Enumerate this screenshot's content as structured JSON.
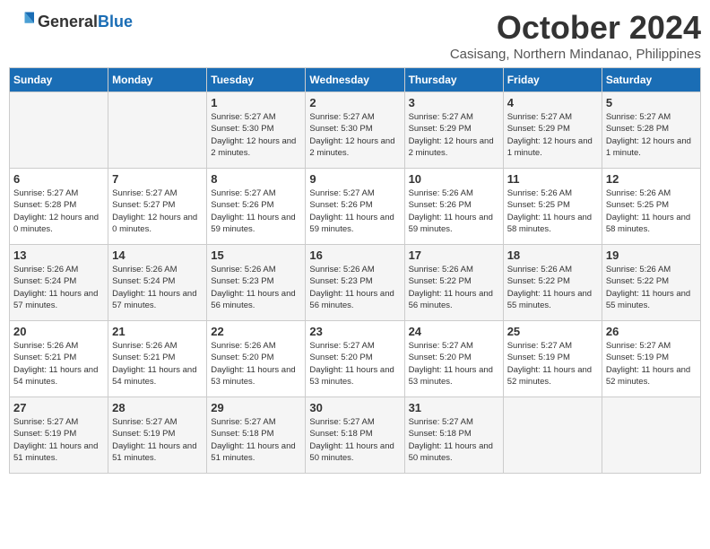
{
  "header": {
    "logo_general": "General",
    "logo_blue": "Blue",
    "month_year": "October 2024",
    "location": "Casisang, Northern Mindanao, Philippines"
  },
  "days_of_week": [
    "Sunday",
    "Monday",
    "Tuesday",
    "Wednesday",
    "Thursday",
    "Friday",
    "Saturday"
  ],
  "weeks": [
    [
      {
        "day": "",
        "info": ""
      },
      {
        "day": "",
        "info": ""
      },
      {
        "day": "1",
        "info": "Sunrise: 5:27 AM\nSunset: 5:30 PM\nDaylight: 12 hours and 2 minutes."
      },
      {
        "day": "2",
        "info": "Sunrise: 5:27 AM\nSunset: 5:30 PM\nDaylight: 12 hours and 2 minutes."
      },
      {
        "day": "3",
        "info": "Sunrise: 5:27 AM\nSunset: 5:29 PM\nDaylight: 12 hours and 2 minutes."
      },
      {
        "day": "4",
        "info": "Sunrise: 5:27 AM\nSunset: 5:29 PM\nDaylight: 12 hours and 1 minute."
      },
      {
        "day": "5",
        "info": "Sunrise: 5:27 AM\nSunset: 5:28 PM\nDaylight: 12 hours and 1 minute."
      }
    ],
    [
      {
        "day": "6",
        "info": "Sunrise: 5:27 AM\nSunset: 5:28 PM\nDaylight: 12 hours and 0 minutes."
      },
      {
        "day": "7",
        "info": "Sunrise: 5:27 AM\nSunset: 5:27 PM\nDaylight: 12 hours and 0 minutes."
      },
      {
        "day": "8",
        "info": "Sunrise: 5:27 AM\nSunset: 5:26 PM\nDaylight: 11 hours and 59 minutes."
      },
      {
        "day": "9",
        "info": "Sunrise: 5:27 AM\nSunset: 5:26 PM\nDaylight: 11 hours and 59 minutes."
      },
      {
        "day": "10",
        "info": "Sunrise: 5:26 AM\nSunset: 5:26 PM\nDaylight: 11 hours and 59 minutes."
      },
      {
        "day": "11",
        "info": "Sunrise: 5:26 AM\nSunset: 5:25 PM\nDaylight: 11 hours and 58 minutes."
      },
      {
        "day": "12",
        "info": "Sunrise: 5:26 AM\nSunset: 5:25 PM\nDaylight: 11 hours and 58 minutes."
      }
    ],
    [
      {
        "day": "13",
        "info": "Sunrise: 5:26 AM\nSunset: 5:24 PM\nDaylight: 11 hours and 57 minutes."
      },
      {
        "day": "14",
        "info": "Sunrise: 5:26 AM\nSunset: 5:24 PM\nDaylight: 11 hours and 57 minutes."
      },
      {
        "day": "15",
        "info": "Sunrise: 5:26 AM\nSunset: 5:23 PM\nDaylight: 11 hours and 56 minutes."
      },
      {
        "day": "16",
        "info": "Sunrise: 5:26 AM\nSunset: 5:23 PM\nDaylight: 11 hours and 56 minutes."
      },
      {
        "day": "17",
        "info": "Sunrise: 5:26 AM\nSunset: 5:22 PM\nDaylight: 11 hours and 56 minutes."
      },
      {
        "day": "18",
        "info": "Sunrise: 5:26 AM\nSunset: 5:22 PM\nDaylight: 11 hours and 55 minutes."
      },
      {
        "day": "19",
        "info": "Sunrise: 5:26 AM\nSunset: 5:22 PM\nDaylight: 11 hours and 55 minutes."
      }
    ],
    [
      {
        "day": "20",
        "info": "Sunrise: 5:26 AM\nSunset: 5:21 PM\nDaylight: 11 hours and 54 minutes."
      },
      {
        "day": "21",
        "info": "Sunrise: 5:26 AM\nSunset: 5:21 PM\nDaylight: 11 hours and 54 minutes."
      },
      {
        "day": "22",
        "info": "Sunrise: 5:26 AM\nSunset: 5:20 PM\nDaylight: 11 hours and 53 minutes."
      },
      {
        "day": "23",
        "info": "Sunrise: 5:27 AM\nSunset: 5:20 PM\nDaylight: 11 hours and 53 minutes."
      },
      {
        "day": "24",
        "info": "Sunrise: 5:27 AM\nSunset: 5:20 PM\nDaylight: 11 hours and 53 minutes."
      },
      {
        "day": "25",
        "info": "Sunrise: 5:27 AM\nSunset: 5:19 PM\nDaylight: 11 hours and 52 minutes."
      },
      {
        "day": "26",
        "info": "Sunrise: 5:27 AM\nSunset: 5:19 PM\nDaylight: 11 hours and 52 minutes."
      }
    ],
    [
      {
        "day": "27",
        "info": "Sunrise: 5:27 AM\nSunset: 5:19 PM\nDaylight: 11 hours and 51 minutes."
      },
      {
        "day": "28",
        "info": "Sunrise: 5:27 AM\nSunset: 5:19 PM\nDaylight: 11 hours and 51 minutes."
      },
      {
        "day": "29",
        "info": "Sunrise: 5:27 AM\nSunset: 5:18 PM\nDaylight: 11 hours and 51 minutes."
      },
      {
        "day": "30",
        "info": "Sunrise: 5:27 AM\nSunset: 5:18 PM\nDaylight: 11 hours and 50 minutes."
      },
      {
        "day": "31",
        "info": "Sunrise: 5:27 AM\nSunset: 5:18 PM\nDaylight: 11 hours and 50 minutes."
      },
      {
        "day": "",
        "info": ""
      },
      {
        "day": "",
        "info": ""
      }
    ]
  ]
}
